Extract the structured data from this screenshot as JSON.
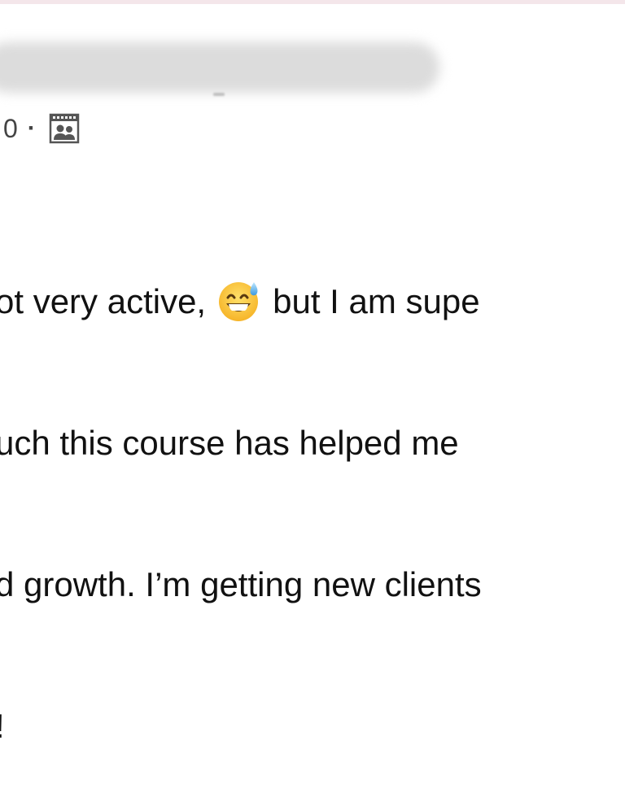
{
  "post": {
    "author_name": "",
    "timestamp_fragment": "0",
    "separator": "·",
    "audience_icon": "group-audience-icon",
    "body": {
      "line1_before_emoji": "ot very active,",
      "emoji": "grinning-face-with-sweat-emoji",
      "line1_after_emoji": "but I am supe",
      "line2": "uch this course has helped me",
      "line3": "d growth. I’m getting new clients",
      "line4": "!"
    }
  },
  "colors": {
    "top_strip": "#f4e6ea",
    "text": "#111111",
    "meta_text": "#444444"
  }
}
